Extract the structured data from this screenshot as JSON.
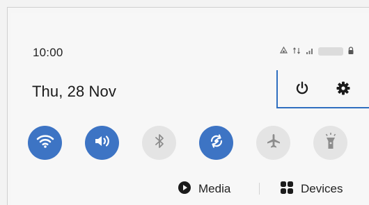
{
  "status_bar": {
    "time": "10:00",
    "icons": [
      "data-sync-icon",
      "network-icon",
      "signal-icon",
      "hidden-text",
      "lock-icon"
    ]
  },
  "header": {
    "date": "Thu, 28 Nov",
    "power_icon": "power-icon",
    "settings_icon": "gear-icon"
  },
  "quick_tiles": [
    {
      "name": "wifi",
      "state": "on"
    },
    {
      "name": "sound",
      "state": "on"
    },
    {
      "name": "bluetooth",
      "state": "off"
    },
    {
      "name": "auto-rotate",
      "state": "on"
    },
    {
      "name": "airplane-mode",
      "state": "off"
    },
    {
      "name": "flashlight",
      "state": "off"
    }
  ],
  "bottom_bar": {
    "media_label": "Media",
    "devices_label": "Devices"
  },
  "colors": {
    "accent": "#3d74c4",
    "tile_off": "#e4e4e4",
    "callout": "#2f6fc0"
  }
}
